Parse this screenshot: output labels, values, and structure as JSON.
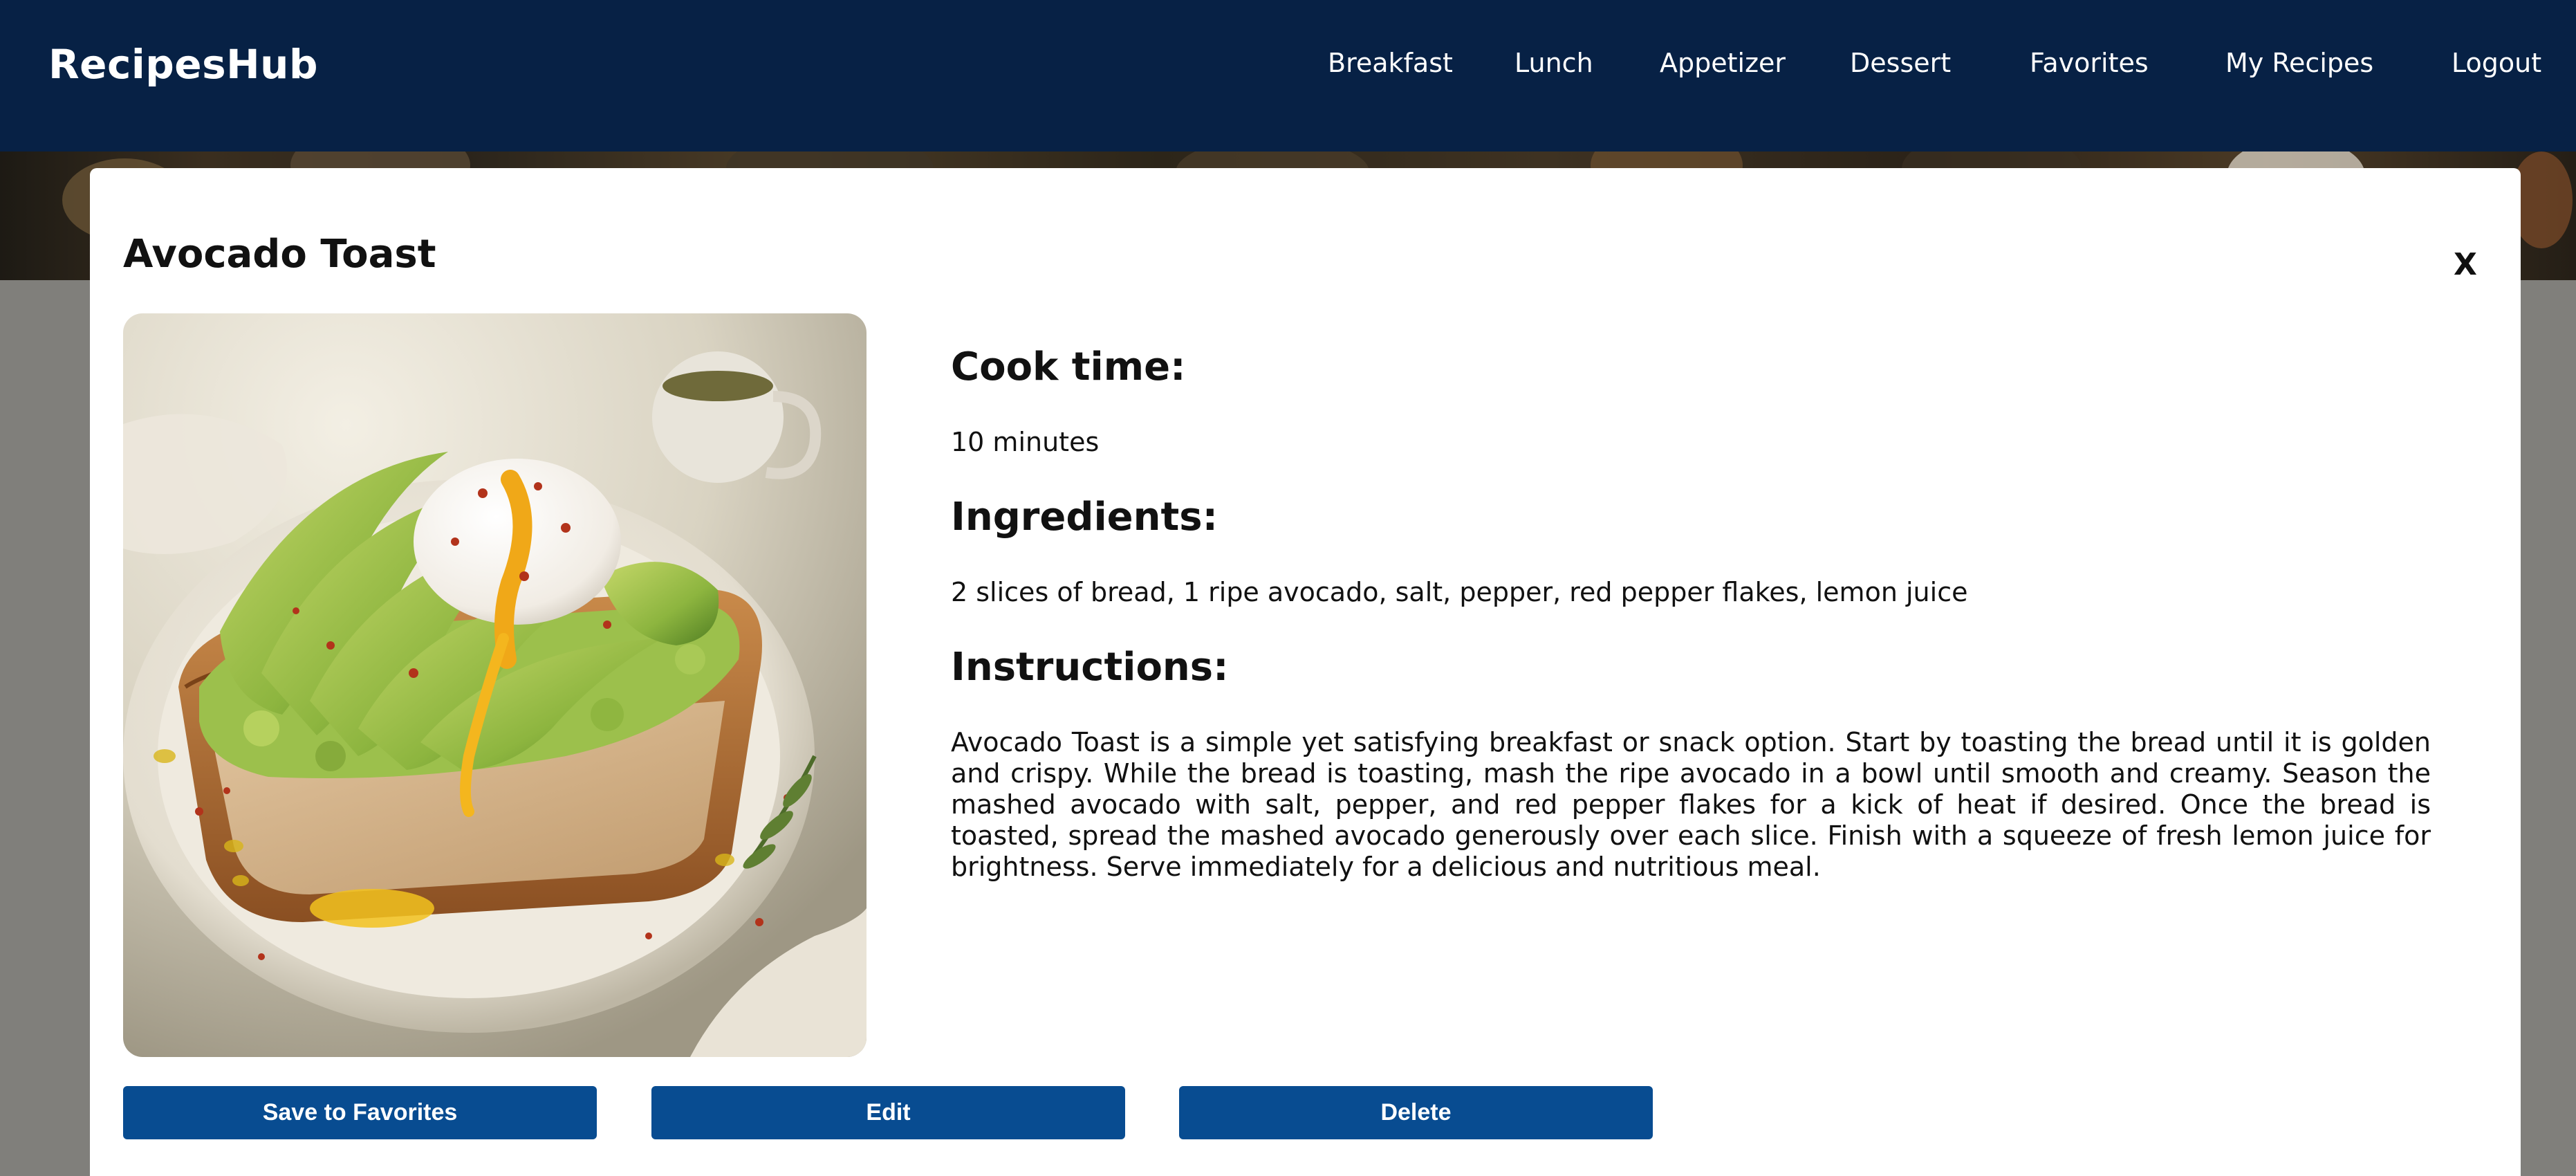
{
  "navbar": {
    "brand": "RecipesHub",
    "items": [
      {
        "label": "Breakfast"
      },
      {
        "label": "Lunch"
      },
      {
        "label": "Appetizer"
      },
      {
        "label": "Dessert"
      },
      {
        "label": "Favorites"
      },
      {
        "label": "My Recipes"
      },
      {
        "label": "Logout"
      }
    ]
  },
  "modal": {
    "title": "Avocado Toast",
    "close_label": "X",
    "image_alt": "Avocado toast with poached egg on a white plate",
    "cook_time_heading": "Cook time:",
    "cook_time": "10 minutes",
    "ingredients_heading": "Ingredients:",
    "ingredients": "2 slices of bread, 1 ripe avocado, salt, pepper, red pepper flakes, lemon juice",
    "instructions_heading": "Instructions:",
    "instructions": "Avocado Toast is a simple yet satisfying breakfast or snack option. Start by toasting the bread until it is golden and crispy. While the bread is toasting, mash the ripe avocado in a bowl until smooth and creamy. Season the mashed avocado with salt, pepper, and red pepper flakes for a kick of heat if desired. Once the bread is toasted, spread the mashed avocado generously over each slice. Finish with a squeeze of fresh lemon juice for brightness. Serve immediately for a delicious and nutritious meal.",
    "buttons": {
      "save": "Save to Favorites",
      "edit": "Edit",
      "delete": "Delete"
    }
  },
  "colors": {
    "navbar_bg": "#072145",
    "button_bg": "#084c91",
    "overlay_bg": "#807f7b",
    "modal_bg": "#ffffff"
  }
}
